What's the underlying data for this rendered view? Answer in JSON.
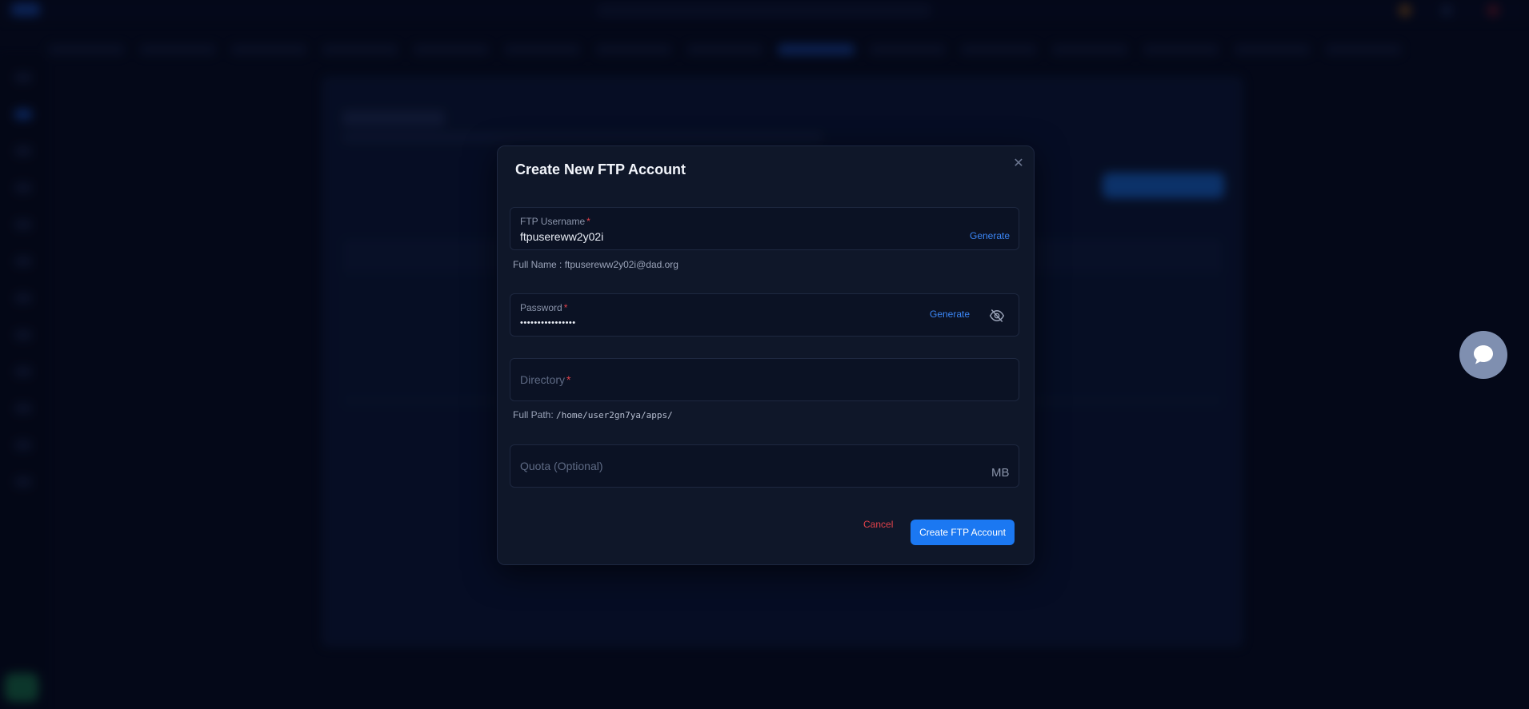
{
  "modal": {
    "title": "Create New FTP Account",
    "username": {
      "label": "FTP Username",
      "required_mark": "*",
      "value": "ftpusereww2y02i",
      "generate_label": "Generate",
      "helper_label": "Full Name :",
      "helper_value": "ftpusereww2y02i@dad.org"
    },
    "password": {
      "label": "Password",
      "required_mark": "*",
      "masked_value": "••••••••••••••••",
      "generate_label": "Generate",
      "visibility_icon": "eye-off-icon"
    },
    "directory": {
      "placeholder": "Directory",
      "required_mark": "*",
      "helper_label": "Full Path:",
      "helper_value": "/home/user2gn7ya/apps/"
    },
    "quota": {
      "placeholder": "Quota (Optional)",
      "unit": "MB"
    },
    "cancel_label": "Cancel",
    "submit_label": "Create FTP Account",
    "close_icon": "close-icon"
  },
  "colors": {
    "accent": "#1b78f2",
    "danger": "#e0424a",
    "modal_bg": "#0f1729",
    "page_bg": "#050a1c"
  },
  "chat_widget": {
    "icon": "chat-bubble-icon"
  }
}
